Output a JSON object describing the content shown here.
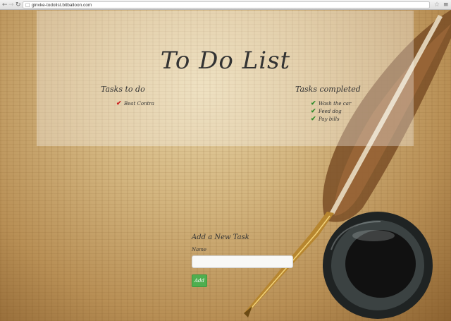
{
  "browser": {
    "url": "ginvke-todolist.bitballoon.com",
    "icons": {
      "back": "back-arrow-icon",
      "forward": "forward-arrow-icon",
      "reload": "reload-icon",
      "page": "page-icon",
      "star": "star-icon",
      "menu": "menu-icon"
    }
  },
  "page": {
    "title": "To Do List",
    "todo": {
      "heading": "Tasks to do",
      "items": [
        "Beat Contra"
      ]
    },
    "completed": {
      "heading": "Tasks completed",
      "items": [
        "Wash the car",
        "Feed dog",
        "Pay bills"
      ]
    },
    "form": {
      "heading": "Add a New Task",
      "name_label": "Name",
      "name_value": "",
      "add_label": "Add"
    }
  },
  "colors": {
    "todo_check": "#cc1f1f",
    "done_check": "#2f8a2a",
    "add_button": "#4fae4f"
  }
}
